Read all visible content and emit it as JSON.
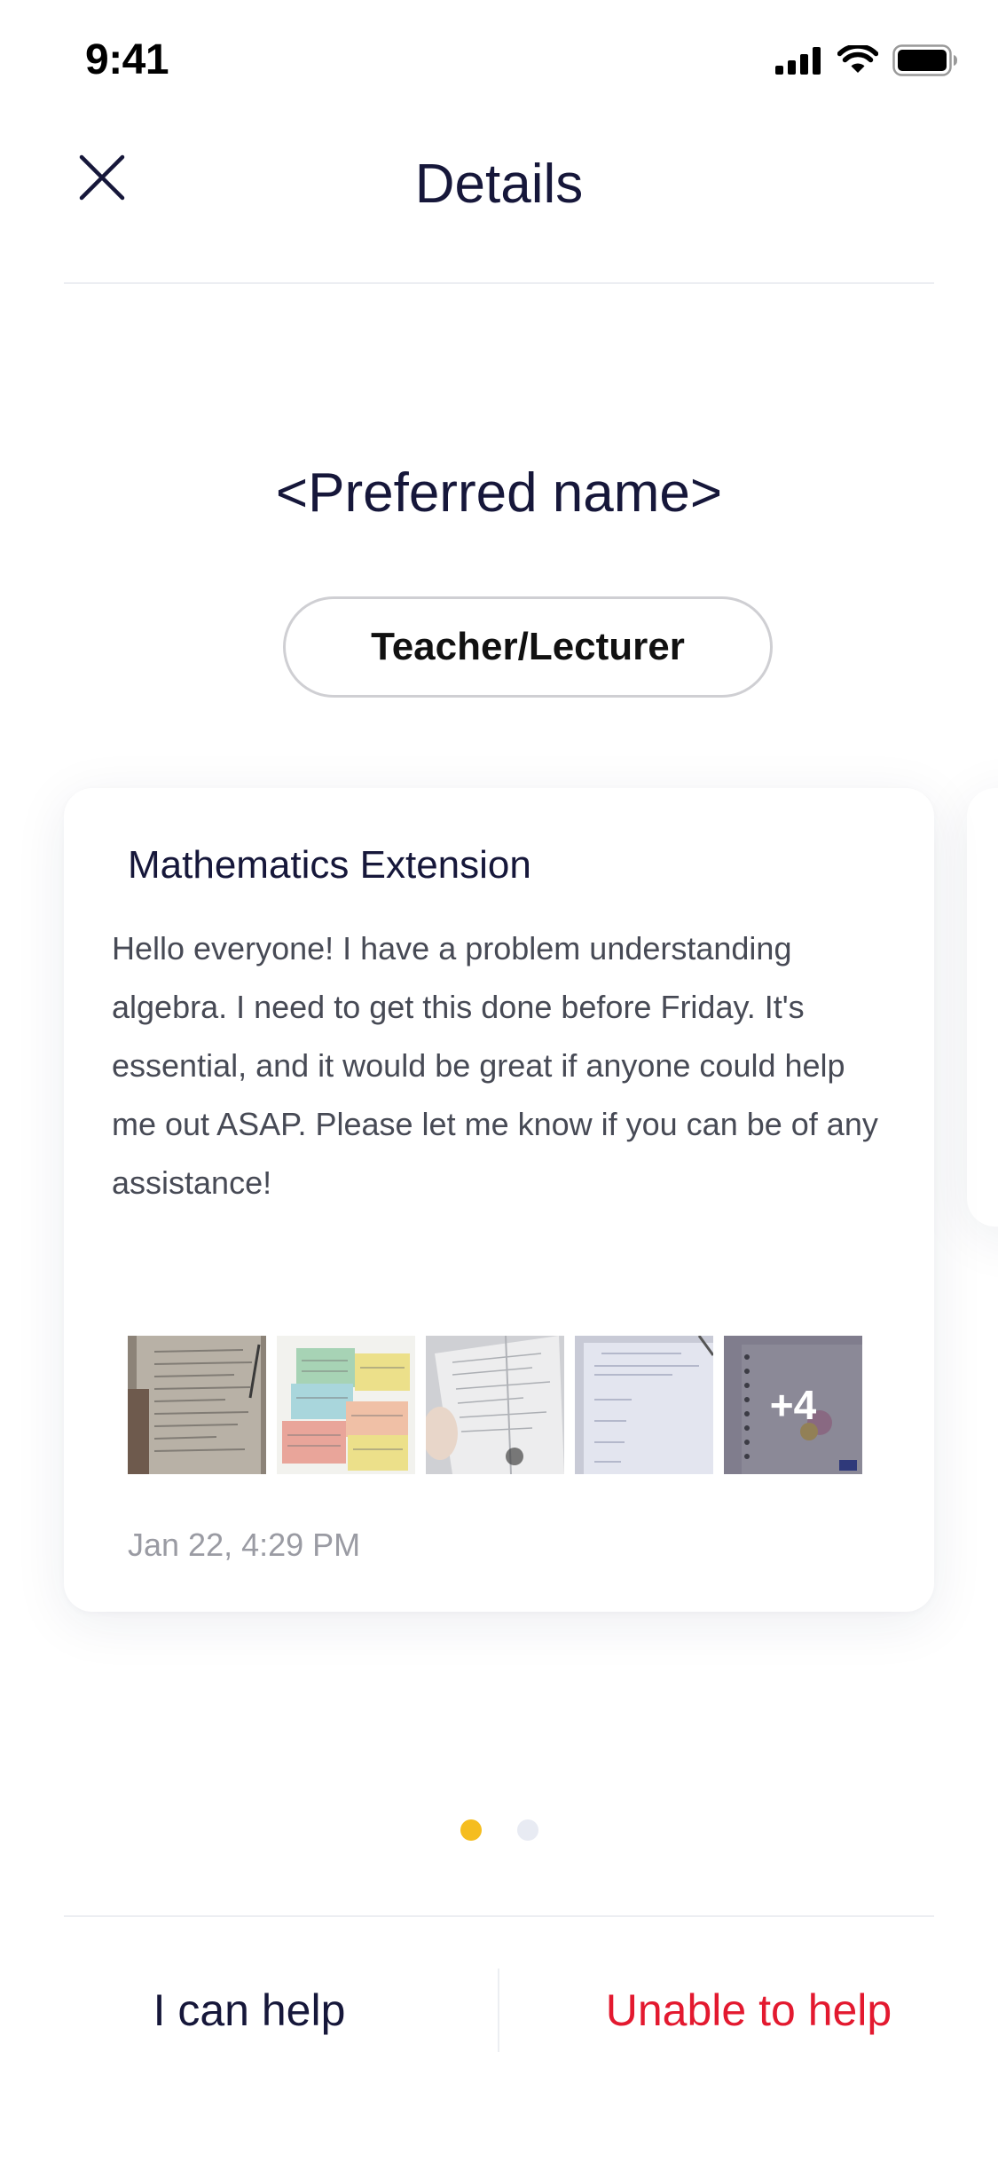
{
  "status_bar": {
    "time": "9:41",
    "icons": [
      "cellular-signal-icon",
      "wifi-icon",
      "battery-icon"
    ]
  },
  "header": {
    "title": "Details",
    "close_icon": "close-icon"
  },
  "profile": {
    "preferred_name": "<Preferred name>",
    "role": "Teacher/Lecturer"
  },
  "card": {
    "subject": "Mathematics Extension",
    "body": "Hello everyone! I have a problem understanding algebra. I need to get this done before Friday. It's essential, and it would be great if anyone could help me out ASAP. Please let me know if you can be of any assistance!",
    "attachments_more": "+4",
    "timestamp": "Jan 22, 4:29 PM"
  },
  "pagination": {
    "total": 2,
    "active_index": 0,
    "active_color": "#f5bd1f",
    "inactive_color": "#e8ebf3"
  },
  "actions": {
    "help_label": "I can help",
    "unable_label": "Unable to help",
    "unable_color": "#e3192f"
  }
}
